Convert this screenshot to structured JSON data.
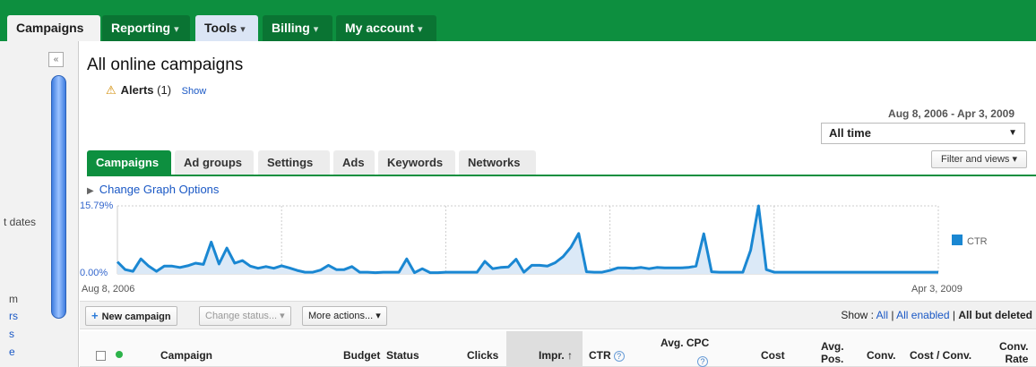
{
  "topnav": {
    "tabs": [
      {
        "label": "Campaigns",
        "caret": ""
      },
      {
        "label": "Reporting",
        "caret": "▾"
      },
      {
        "label": "Tools",
        "caret": "▾"
      },
      {
        "label": "Billing",
        "caret": "▾"
      },
      {
        "label": "My account",
        "caret": "▾"
      }
    ]
  },
  "sidebar": {
    "collapse_glyph": "«",
    "fragments": [
      "t dates",
      "m",
      "rs",
      "s",
      "e"
    ]
  },
  "page": {
    "title": "All online campaigns",
    "alerts_label": "Alerts",
    "alerts_count": "(1)",
    "alerts_show": "Show",
    "warning_glyph": "⚠"
  },
  "date": {
    "range": "Aug 8, 2006 - Apr 3, 2009",
    "selected": "All time",
    "arrow": "▼"
  },
  "subtabs": [
    "Campaigns",
    "Ad groups",
    "Settings",
    "Ads",
    "Keywords",
    "Networks"
  ],
  "filter_label": "Filter and views ▾",
  "graph_options": "Change Graph Options",
  "chart_data": {
    "type": "area",
    "series": [
      {
        "name": "CTR",
        "values": [
          2.8,
          1.0,
          0.6,
          3.5,
          1.8,
          0.6,
          1.8,
          1.8,
          1.5,
          1.9,
          2.5,
          2.2,
          7.4,
          2.3,
          6.0,
          2.5,
          3.1,
          1.8,
          1.3,
          1.7,
          1.3,
          1.9,
          1.4,
          0.8,
          0.4,
          0.4,
          0.9,
          2.0,
          1.0,
          1.0,
          1.7,
          0.4,
          0.4,
          0.3,
          0.4,
          0.4,
          0.4,
          3.5,
          0.3,
          1.2,
          0.3,
          0.3,
          0.4,
          0.4,
          0.4,
          0.4,
          0.4,
          2.9,
          1.2,
          1.5,
          1.6,
          3.4,
          0.4,
          2.0,
          2.0,
          1.8,
          2.6,
          4.0,
          6.2,
          9.4,
          0.5,
          0.4,
          0.4,
          0.8,
          1.4,
          1.4,
          1.3,
          1.5,
          1.2,
          1.5,
          1.4,
          1.4,
          1.4,
          1.5,
          1.8,
          9.3,
          0.5,
          0.4,
          0.4,
          0.4,
          0.4,
          5.5,
          15.79,
          1.0,
          0.4,
          0.4,
          0.4,
          0.4,
          0.4,
          0.4,
          0.4,
          0.4,
          0.4,
          0.4,
          0.4,
          0.4,
          0.4,
          0.4,
          0.4,
          0.4,
          0.4,
          0.4,
          0.4,
          0.4,
          0.4,
          0.4
        ]
      }
    ],
    "ylim": [
      0,
      15.79
    ],
    "y_tick_labels": [
      "0.00%",
      "15.79%"
    ],
    "x_tick_labels": [
      "Aug 8, 2006",
      "Apr 3, 2009"
    ],
    "legend_position": "right",
    "color": "#1a87d2",
    "fill": "#dbe9f7"
  },
  "toolbar": {
    "new_campaign": "New campaign",
    "plus_glyph": "+",
    "change_status": "Change status... ▾",
    "more_actions": "More actions... ▾",
    "show_label": "Show :",
    "show_all": "All",
    "show_enabled": "All enabled",
    "show_deleted": "All but deleted"
  },
  "table": {
    "columns": {
      "campaign": "Campaign",
      "budget": "Budget",
      "status": "Status",
      "clicks": "Clicks",
      "impr": "Impr. ↑",
      "ctr": "CTR",
      "avg_cpc_1": "Avg. CPC",
      "cost": "Cost",
      "avg_pos_1": "Avg.",
      "avg_pos_2": "Pos.",
      "conv": "Conv.",
      "cost_conv": "Cost / Conv.",
      "conv_rate_1": "Conv.",
      "conv_rate_2": "Rate"
    },
    "help_glyph": "?"
  }
}
